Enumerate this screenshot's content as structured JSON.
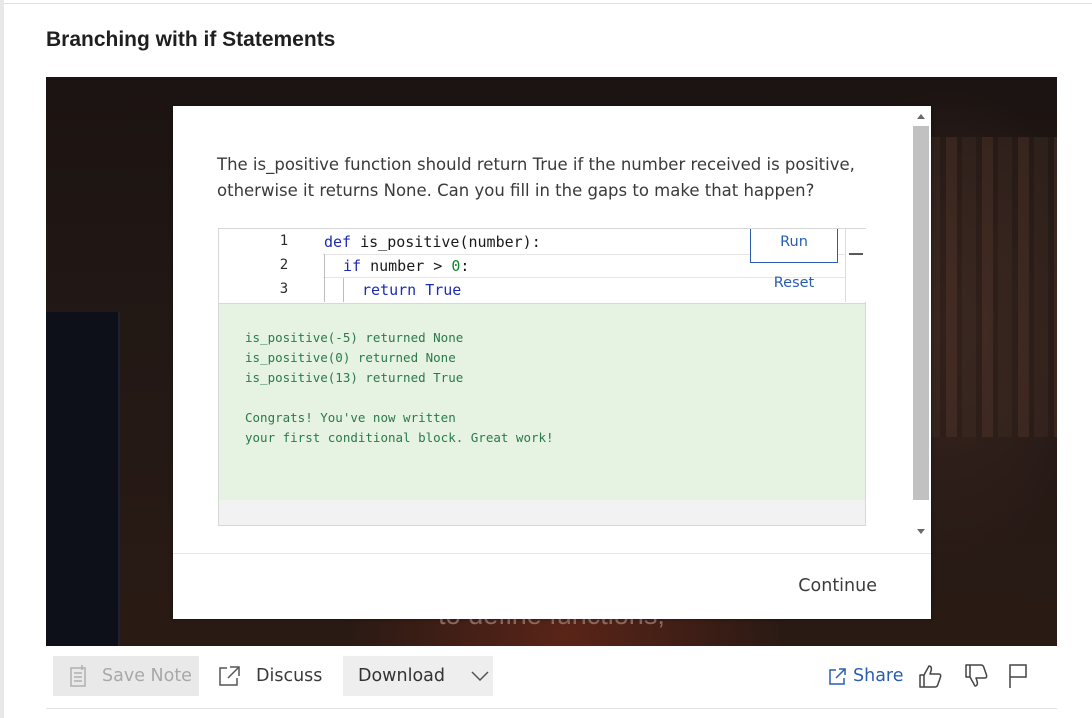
{
  "page": {
    "title": "Branching with if Statements"
  },
  "video": {
    "subtitle": "to define functions,"
  },
  "modal": {
    "prompt": "The is_positive function should return True if the number received is positive, otherwise it returns None. Can you fill in the gaps to make that happen?",
    "editor": {
      "line_numbers": [
        "1",
        "2",
        "3"
      ],
      "lines": [
        {
          "kw": "def",
          "rest": " is_positive(number):"
        },
        {
          "kw": "if",
          "rest": " number > ",
          "num": "0",
          "tail": ":"
        },
        {
          "kw": "return",
          "rest": " True"
        }
      ],
      "run_label": "Run",
      "reset_label": "Reset"
    },
    "output": [
      "is_positive(-5) returned None",
      "is_positive(0) returned None",
      "is_positive(13) returned True",
      "",
      "Congrats! You've now written",
      "your first conditional block. Great work!"
    ],
    "continue_label": "Continue"
  },
  "toolbar": {
    "save_note_label": "Save Note",
    "discuss_label": "Discuss",
    "download_label": "Download",
    "share_label": "Share"
  },
  "icons": {
    "save_note": "note-icon",
    "discuss": "external-link-icon",
    "download": "chevron-down-icon",
    "share": "share-icon",
    "like": "thumbs-up-icon",
    "dislike": "thumbs-down-icon",
    "report": "flag-icon"
  },
  "colors": {
    "accent": "#2a5db0",
    "output_bg": "#e6f2e2",
    "output_text": "#2a7a4a",
    "keyword": "#1d2bb5",
    "number": "#0a8a2a"
  }
}
